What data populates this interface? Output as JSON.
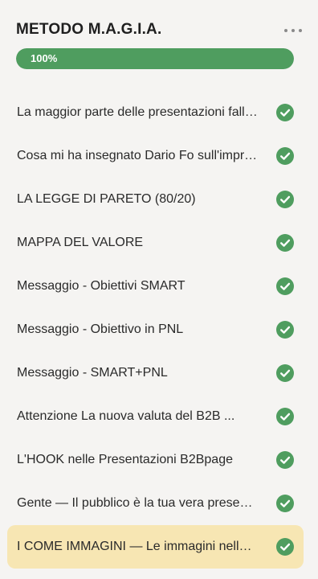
{
  "course": {
    "title": "METODO M.A.G.I.A.",
    "more_icon": "more-horizontal-icon"
  },
  "progress": {
    "label": "100%",
    "value": 1.0,
    "fill_color": "#4f9d5f",
    "track_color": "#dcdcdc"
  },
  "lessons": [
    {
      "label": "La maggior parte delle presentazioni fallisce",
      "completed": true,
      "active": false
    },
    {
      "label": "Cosa mi ha insegnato Dario Fo sull'improvvisazione",
      "completed": true,
      "active": false
    },
    {
      "label": "LA LEGGE DI PARETO (80/20)",
      "completed": true,
      "active": false
    },
    {
      "label": "MAPPA DEL VALORE",
      "completed": true,
      "active": false
    },
    {
      "label": "Messaggio - Obiettivi SMART",
      "completed": true,
      "active": false
    },
    {
      "label": "Messaggio - Obiettivo in PNL",
      "completed": true,
      "active": false
    },
    {
      "label": "Messaggio - SMART+PNL",
      "completed": true,
      "active": false
    },
    {
      "label": "Attenzione La nuova valuta del B2B ...",
      "completed": true,
      "active": false
    },
    {
      "label": "L'HOOK nelle Presentazioni B2Bpage",
      "completed": true,
      "active": false
    },
    {
      "label": "Gente — Il pubblico è la tua vera presenza",
      "completed": true,
      "active": false
    },
    {
      "label": "I COME IMMAGINI — Le immagini nelle presentazioni",
      "completed": true,
      "active": true
    }
  ],
  "colors": {
    "check": "#4f9d5f",
    "active_row": "#f7e6b3",
    "background": "#f5f4f2"
  },
  "icons": {
    "check": "check-circle-icon"
  }
}
